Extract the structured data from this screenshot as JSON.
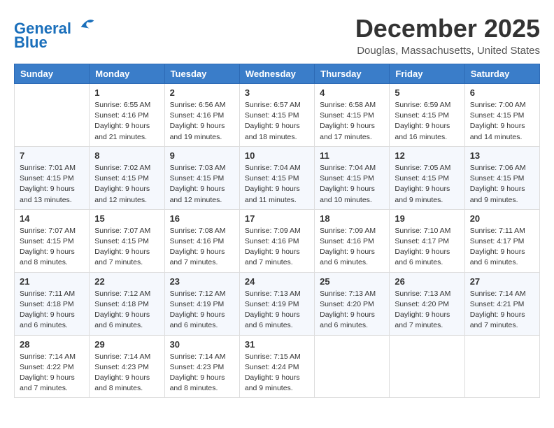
{
  "header": {
    "logo_line1": "General",
    "logo_line2": "Blue",
    "month_title": "December 2025",
    "location": "Douglas, Massachusetts, United States"
  },
  "days_of_week": [
    "Sunday",
    "Monday",
    "Tuesday",
    "Wednesday",
    "Thursday",
    "Friday",
    "Saturday"
  ],
  "weeks": [
    [
      {
        "day": "",
        "sunrise": "",
        "sunset": "",
        "daylight": ""
      },
      {
        "day": "1",
        "sunrise": "Sunrise: 6:55 AM",
        "sunset": "Sunset: 4:16 PM",
        "daylight": "Daylight: 9 hours and 21 minutes."
      },
      {
        "day": "2",
        "sunrise": "Sunrise: 6:56 AM",
        "sunset": "Sunset: 4:16 PM",
        "daylight": "Daylight: 9 hours and 19 minutes."
      },
      {
        "day": "3",
        "sunrise": "Sunrise: 6:57 AM",
        "sunset": "Sunset: 4:15 PM",
        "daylight": "Daylight: 9 hours and 18 minutes."
      },
      {
        "day": "4",
        "sunrise": "Sunrise: 6:58 AM",
        "sunset": "Sunset: 4:15 PM",
        "daylight": "Daylight: 9 hours and 17 minutes."
      },
      {
        "day": "5",
        "sunrise": "Sunrise: 6:59 AM",
        "sunset": "Sunset: 4:15 PM",
        "daylight": "Daylight: 9 hours and 16 minutes."
      },
      {
        "day": "6",
        "sunrise": "Sunrise: 7:00 AM",
        "sunset": "Sunset: 4:15 PM",
        "daylight": "Daylight: 9 hours and 14 minutes."
      }
    ],
    [
      {
        "day": "7",
        "sunrise": "Sunrise: 7:01 AM",
        "sunset": "Sunset: 4:15 PM",
        "daylight": "Daylight: 9 hours and 13 minutes."
      },
      {
        "day": "8",
        "sunrise": "Sunrise: 7:02 AM",
        "sunset": "Sunset: 4:15 PM",
        "daylight": "Daylight: 9 hours and 12 minutes."
      },
      {
        "day": "9",
        "sunrise": "Sunrise: 7:03 AM",
        "sunset": "Sunset: 4:15 PM",
        "daylight": "Daylight: 9 hours and 12 minutes."
      },
      {
        "day": "10",
        "sunrise": "Sunrise: 7:04 AM",
        "sunset": "Sunset: 4:15 PM",
        "daylight": "Daylight: 9 hours and 11 minutes."
      },
      {
        "day": "11",
        "sunrise": "Sunrise: 7:04 AM",
        "sunset": "Sunset: 4:15 PM",
        "daylight": "Daylight: 9 hours and 10 minutes."
      },
      {
        "day": "12",
        "sunrise": "Sunrise: 7:05 AM",
        "sunset": "Sunset: 4:15 PM",
        "daylight": "Daylight: 9 hours and 9 minutes."
      },
      {
        "day": "13",
        "sunrise": "Sunrise: 7:06 AM",
        "sunset": "Sunset: 4:15 PM",
        "daylight": "Daylight: 9 hours and 9 minutes."
      }
    ],
    [
      {
        "day": "14",
        "sunrise": "Sunrise: 7:07 AM",
        "sunset": "Sunset: 4:15 PM",
        "daylight": "Daylight: 9 hours and 8 minutes."
      },
      {
        "day": "15",
        "sunrise": "Sunrise: 7:07 AM",
        "sunset": "Sunset: 4:15 PM",
        "daylight": "Daylight: 9 hours and 7 minutes."
      },
      {
        "day": "16",
        "sunrise": "Sunrise: 7:08 AM",
        "sunset": "Sunset: 4:16 PM",
        "daylight": "Daylight: 9 hours and 7 minutes."
      },
      {
        "day": "17",
        "sunrise": "Sunrise: 7:09 AM",
        "sunset": "Sunset: 4:16 PM",
        "daylight": "Daylight: 9 hours and 7 minutes."
      },
      {
        "day": "18",
        "sunrise": "Sunrise: 7:09 AM",
        "sunset": "Sunset: 4:16 PM",
        "daylight": "Daylight: 9 hours and 6 minutes."
      },
      {
        "day": "19",
        "sunrise": "Sunrise: 7:10 AM",
        "sunset": "Sunset: 4:17 PM",
        "daylight": "Daylight: 9 hours and 6 minutes."
      },
      {
        "day": "20",
        "sunrise": "Sunrise: 7:11 AM",
        "sunset": "Sunset: 4:17 PM",
        "daylight": "Daylight: 9 hours and 6 minutes."
      }
    ],
    [
      {
        "day": "21",
        "sunrise": "Sunrise: 7:11 AM",
        "sunset": "Sunset: 4:18 PM",
        "daylight": "Daylight: 9 hours and 6 minutes."
      },
      {
        "day": "22",
        "sunrise": "Sunrise: 7:12 AM",
        "sunset": "Sunset: 4:18 PM",
        "daylight": "Daylight: 9 hours and 6 minutes."
      },
      {
        "day": "23",
        "sunrise": "Sunrise: 7:12 AM",
        "sunset": "Sunset: 4:19 PM",
        "daylight": "Daylight: 9 hours and 6 minutes."
      },
      {
        "day": "24",
        "sunrise": "Sunrise: 7:13 AM",
        "sunset": "Sunset: 4:19 PM",
        "daylight": "Daylight: 9 hours and 6 minutes."
      },
      {
        "day": "25",
        "sunrise": "Sunrise: 7:13 AM",
        "sunset": "Sunset: 4:20 PM",
        "daylight": "Daylight: 9 hours and 6 minutes."
      },
      {
        "day": "26",
        "sunrise": "Sunrise: 7:13 AM",
        "sunset": "Sunset: 4:20 PM",
        "daylight": "Daylight: 9 hours and 7 minutes."
      },
      {
        "day": "27",
        "sunrise": "Sunrise: 7:14 AM",
        "sunset": "Sunset: 4:21 PM",
        "daylight": "Daylight: 9 hours and 7 minutes."
      }
    ],
    [
      {
        "day": "28",
        "sunrise": "Sunrise: 7:14 AM",
        "sunset": "Sunset: 4:22 PM",
        "daylight": "Daylight: 9 hours and 7 minutes."
      },
      {
        "day": "29",
        "sunrise": "Sunrise: 7:14 AM",
        "sunset": "Sunset: 4:23 PM",
        "daylight": "Daylight: 9 hours and 8 minutes."
      },
      {
        "day": "30",
        "sunrise": "Sunrise: 7:14 AM",
        "sunset": "Sunset: 4:23 PM",
        "daylight": "Daylight: 9 hours and 8 minutes."
      },
      {
        "day": "31",
        "sunrise": "Sunrise: 7:15 AM",
        "sunset": "Sunset: 4:24 PM",
        "daylight": "Daylight: 9 hours and 9 minutes."
      },
      {
        "day": "",
        "sunrise": "",
        "sunset": "",
        "daylight": ""
      },
      {
        "day": "",
        "sunrise": "",
        "sunset": "",
        "daylight": ""
      },
      {
        "day": "",
        "sunrise": "",
        "sunset": "",
        "daylight": ""
      }
    ]
  ]
}
